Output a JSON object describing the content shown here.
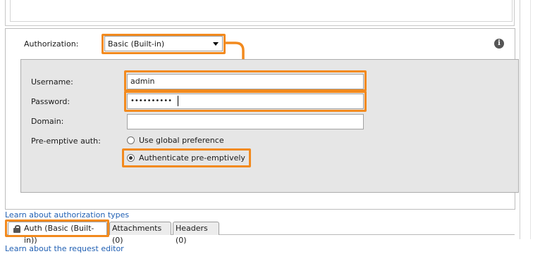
{
  "authorization": {
    "label": "Authorization:",
    "selected": "Basic (Built-in)",
    "info_icon_glyph": "i"
  },
  "credentials": {
    "username_label": "Username:",
    "username_value": "admin",
    "password_label": "Password:",
    "password_value": "••••••••••",
    "domain_label": "Domain:",
    "domain_value": "",
    "preemptive_label": "Pre-emptive auth:",
    "options": [
      {
        "label": "Use global preference",
        "selected": false
      },
      {
        "label": "Authenticate pre-emptively",
        "selected": true
      }
    ]
  },
  "links": {
    "learn_auth": "Learn about authorization types",
    "learn_editor": "Learn about the request editor"
  },
  "tabs": [
    {
      "label": "Auth (Basic (Built-in))",
      "active": true,
      "icon": "lock-icon"
    },
    {
      "label": "Attachments (0)",
      "active": false
    },
    {
      "label": "Headers (0)",
      "active": false
    }
  ],
  "colors": {
    "highlight": "#f28a1e",
    "link": "#1f5fb3",
    "panel_bg": "#e6e6e6"
  }
}
